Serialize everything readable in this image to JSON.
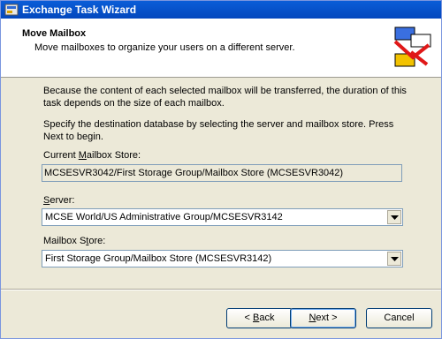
{
  "window": {
    "title": "Exchange Task Wizard"
  },
  "header": {
    "title": "Move Mailbox",
    "subtitle": "Move mailboxes to organize your users on a different server."
  },
  "body": {
    "paragraph1": "Because the content of each selected mailbox will be transferred, the duration of this task depends on the size of each mailbox.",
    "paragraph2": "Specify the destination database by selecting the server and mailbox store. Press Next to begin.",
    "current_store_label": {
      "pre": "Current ",
      "key": "M",
      "post": "ailbox Store:"
    },
    "current_store_value": "MCSESVR3042/First Storage Group/Mailbox Store (MCSESVR3042)",
    "server_label": {
      "pre": "",
      "key": "S",
      "post": "erver:"
    },
    "server_value": "MCSE World/US Administrative Group/MCSESVR3142",
    "store_label": {
      "pre": "Mailbox S",
      "key": "t",
      "post": "ore:"
    },
    "store_value": "First Storage Group/Mailbox Store (MCSESVR3142)"
  },
  "buttons": {
    "back": {
      "pre": "< ",
      "key": "B",
      "post": "ack"
    },
    "next": {
      "pre": "",
      "key": "N",
      "post": "ext >"
    },
    "cancel": "Cancel"
  },
  "icons": {
    "title": "exchange-app-icon",
    "header": "wizard-mailbox-icon",
    "dropdown": "chevron-down-icon"
  }
}
